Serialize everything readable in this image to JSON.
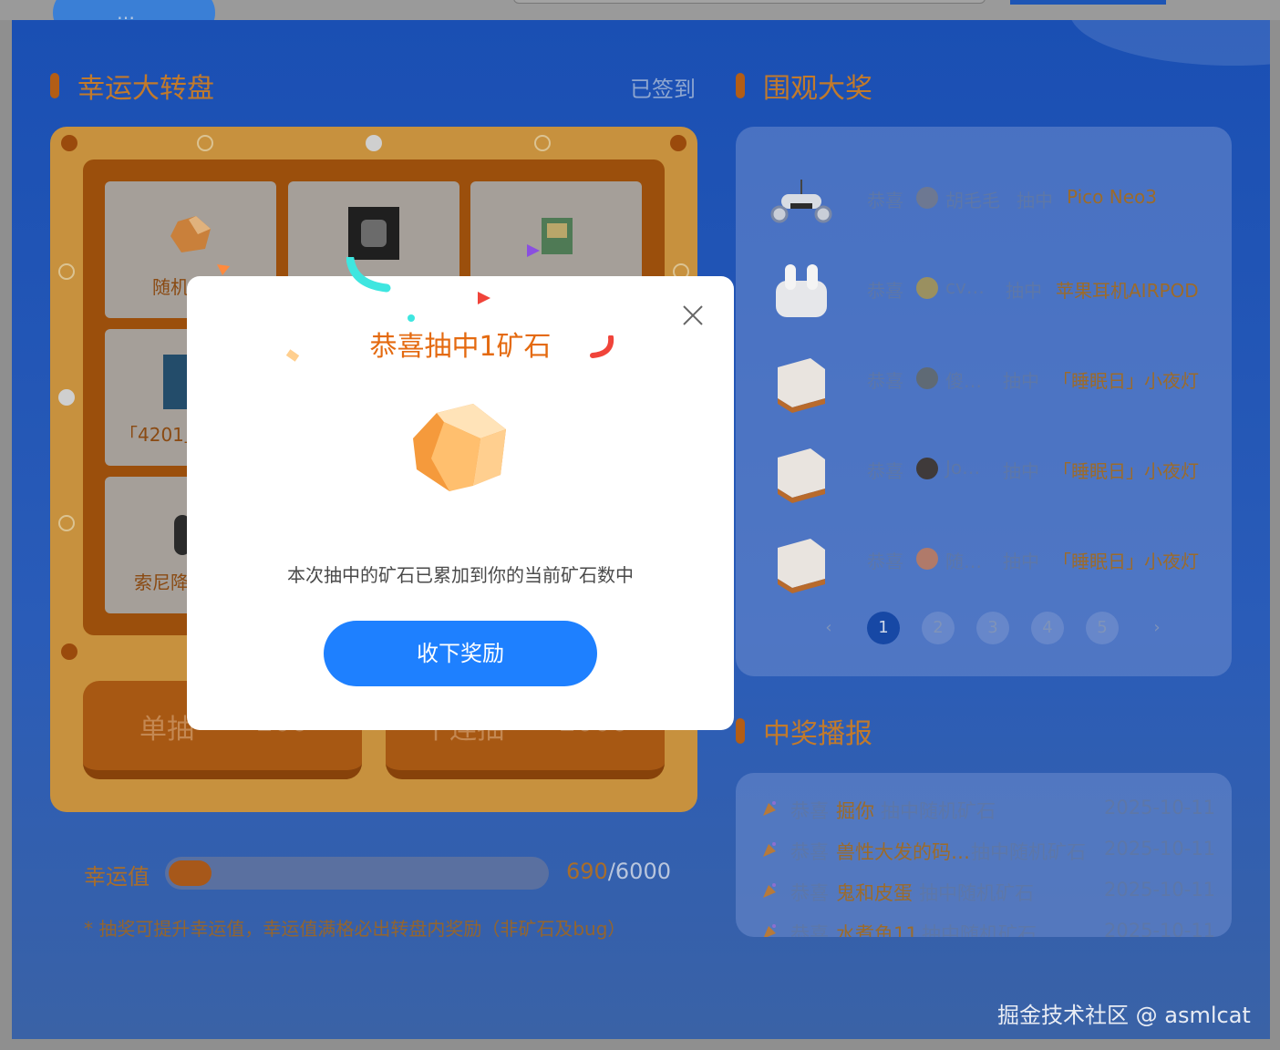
{
  "header": {
    "pill_text": "…"
  },
  "lottery": {
    "title": "幸运大转盘",
    "signed_label": "已签到",
    "cells": [
      {
        "label": "随机",
        "icon": "ore-icon"
      },
      {
        "label": "",
        "icon": "keycap-icon"
      },
      {
        "label": "",
        "icon": "book-icon"
      },
      {
        "label": "「4201」",
        "icon": "book-icon"
      },
      {
        "label": "索尼降",
        "icon": "headphone-icon"
      }
    ],
    "single_draw": {
      "label": "单抽",
      "cost": "200"
    },
    "ten_draw": {
      "label": "十连抽",
      "cost": "2000"
    },
    "luck": {
      "label": "幸运值",
      "current": "690",
      "total": "/6000",
      "fraction": 0.115,
      "note": "* 抽奖可提升幸运值，幸运值满格必出转盘内奖励（非矿石及bug）"
    }
  },
  "winners": {
    "title": "围观大奖",
    "rows": [
      {
        "congrats": "恭喜",
        "user": "胡毛毛",
        "action": "抽中",
        "prize": "Pico Neo3",
        "thumb": "vr-headset-icon"
      },
      {
        "congrats": "恭喜",
        "user": "cv…",
        "action": "抽中",
        "prize": "苹果耳机AIRPOD",
        "thumb": "airpods-icon"
      },
      {
        "congrats": "恭喜",
        "user": "傻…",
        "action": "抽中",
        "prize": "「睡眠日」小夜灯",
        "thumb": "night-lamp-icon"
      },
      {
        "congrats": "恭喜",
        "user": "Jo…",
        "action": "抽中",
        "prize": "「睡眠日」小夜灯",
        "thumb": "night-lamp-icon"
      },
      {
        "congrats": "恭喜",
        "user": "随…",
        "action": "抽中",
        "prize": "「睡眠日」小夜灯",
        "thumb": "night-lamp-icon"
      }
    ],
    "pagination": {
      "prev": "‹",
      "pages": [
        "1",
        "2",
        "3",
        "4",
        "5"
      ],
      "next": "›",
      "active": "1"
    }
  },
  "broadcast": {
    "title": "中奖播报",
    "rows": [
      {
        "congrats": "恭喜",
        "user": "掘你",
        "action": "抽中随机矿石",
        "date": "2025-10-11"
      },
      {
        "congrats": "恭喜",
        "user": "兽性大发的码…",
        "action": "抽中随机矿石",
        "date": "2025-10-11"
      },
      {
        "congrats": "恭喜",
        "user": "鬼和皮蛋",
        "action": "抽中随机矿石",
        "date": "2025-10-11"
      },
      {
        "congrats": "恭喜",
        "user": "水煮鱼11",
        "action": "抽中随机矿石",
        "date": "2025-10-11"
      }
    ]
  },
  "modal": {
    "title": "恭喜抽中1矿石",
    "description": "本次抽中的矿石已累加到你的当前矿石数中",
    "button": "收下奖励"
  },
  "watermark": "掘金技术社区 @ asmlcat",
  "colors": {
    "accent": "#1e80ff",
    "title_orange": "#e46a10",
    "board": "#c7913e"
  }
}
